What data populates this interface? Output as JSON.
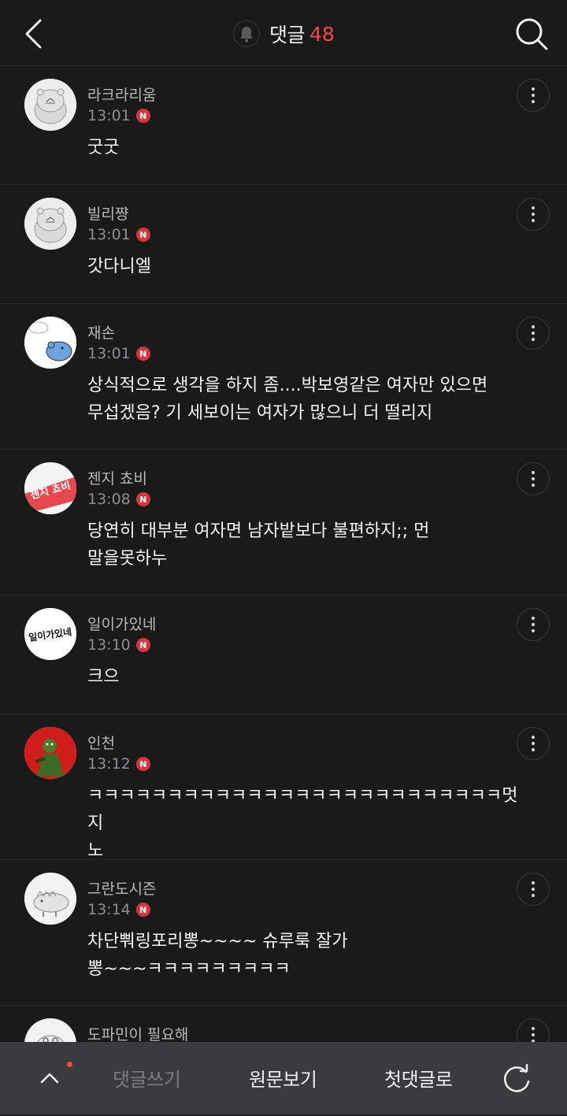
{
  "header": {
    "back_icon": "chevron-left-icon",
    "bell_icon": "bell-icon",
    "title": "댓글",
    "count": "48",
    "search_icon": "search-icon",
    "count_color": "#ef4a44"
  },
  "comments": [
    {
      "nickname": "라크라리움",
      "time": "13:01",
      "badge": "N",
      "text": "굿굿",
      "avatar": "hamster"
    },
    {
      "nickname": "빌리쨩",
      "time": "13:01",
      "badge": "N",
      "text": "갓다니엘",
      "avatar": "hamster"
    },
    {
      "nickname": "재손",
      "time": "13:01",
      "badge": "N",
      "text": "상식적으로 생각을 하지 좀....박보영같은 여자만 있으면\n무섭겠음? 기 세보이는 여자가 많으니 더 떨리지",
      "avatar": "blue-bear"
    },
    {
      "nickname": "젠지 쵸비",
      "time": "13:08",
      "badge": "N",
      "text": "당연히 대부분 여자면 남자밭보다 불편하지;; 먼\n말을못하누",
      "avatar": "text-logo",
      "avatar_text": "젠지 쵸비"
    },
    {
      "nickname": "일이가있네",
      "time": "13:10",
      "badge": "N",
      "text": "크으",
      "avatar": "calligraphy",
      "avatar_text": "일이가있네"
    },
    {
      "nickname": "인천",
      "time": "13:12",
      "badge": "N",
      "text": "ㅋㅋㅋㅋㅋㅋㅋㅋㅋㅋㅋㅋㅋㅋㅋㅋㅋㅋㅋㅋㅋㅋㅋㅋㅋㅋ멋지\n노",
      "avatar": "red-figure"
    },
    {
      "nickname": "그란도시즌",
      "time": "13:14",
      "badge": "N",
      "text": "차단뿨링포리뽕~~~~ 슈루룩 잘가\n뽕~~~ㅋㅋㅋㅋㅋㅋㅋㅋㅋ",
      "avatar": "dino"
    },
    {
      "nickname": "도파민이 필요해",
      "time": "",
      "badge": "",
      "text": "",
      "avatar": "face"
    }
  ],
  "bottombar": {
    "up_icon": "chevron-up-icon",
    "write": "댓글쓰기",
    "original": "원문보기",
    "first": "첫댓글로",
    "refresh_icon": "refresh-icon"
  }
}
